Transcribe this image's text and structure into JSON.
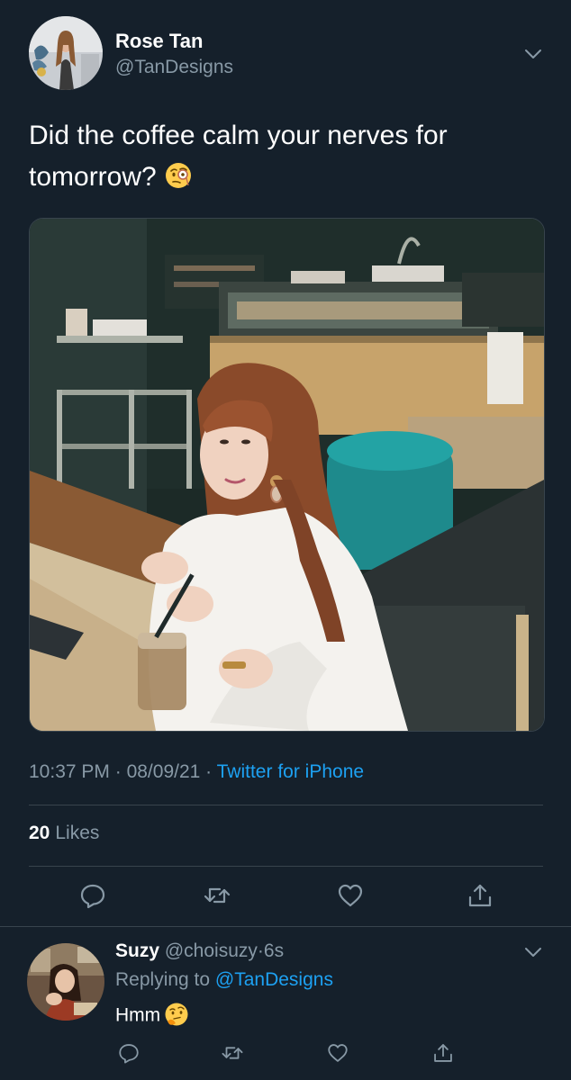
{
  "tweet": {
    "author_name": "Rose Tan",
    "author_handle": "@TanDesigns",
    "text": "Did the coffee calm your nerves for tomorrow?",
    "emoji": "monocle-face-emoji",
    "time": "10:37 PM",
    "separator": "·",
    "date": "08/09/21",
    "source": "Twitter for iPhone",
    "likes_count": "20",
    "likes_label": "Likes",
    "actions": [
      "reply-icon",
      "retweet-icon",
      "like-icon",
      "share-icon"
    ]
  },
  "reply": {
    "author_name": "Suzy",
    "author_handle": "@choisuzy",
    "separator": "·",
    "time": "6s",
    "replying_label": "Replying to",
    "replying_handle": "@TanDesigns",
    "text": "Hmm",
    "emoji": "thinking-face-emoji",
    "actions": [
      "reply-icon",
      "retweet-icon",
      "like-icon",
      "share-icon"
    ]
  },
  "colors": {
    "background": "#15202b",
    "text": "#ffffff",
    "secondary_text": "#8899a6",
    "link": "#1da1f2",
    "divider": "#38444d"
  }
}
